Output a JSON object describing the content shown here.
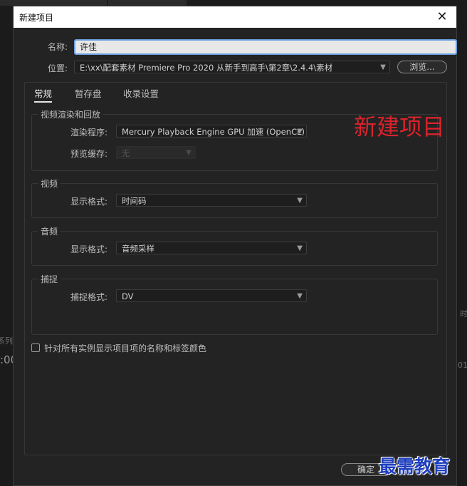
{
  "background": {
    "left_label": "系列",
    "left_time": ":00",
    "right_label": "时",
    "right_time": "01:"
  },
  "dialog": {
    "title": "新建项目",
    "close_glyph": "✕",
    "name_label": "名称:",
    "name_value": "许佳",
    "location_label": "位置:",
    "location_value": "E:\\xx\\配套素材 Premiere Pro 2020 从新手到高手\\第2章\\2.4.4\\素材",
    "browse_label": "浏览..."
  },
  "tabs": [
    {
      "label": "常规",
      "active": true
    },
    {
      "label": "暂存盘",
      "active": false
    },
    {
      "label": "收录设置",
      "active": false
    }
  ],
  "groups": {
    "render": {
      "title": "视频渲染和回放",
      "renderer_label": "渲染程序:",
      "renderer_value": "Mercury Playback Engine GPU 加速 (OpenCL)",
      "preview_cache_label": "预览缓存:",
      "preview_cache_value": "无"
    },
    "video": {
      "title": "视频",
      "display_format_label": "显示格式:",
      "display_format_value": "时间码"
    },
    "audio": {
      "title": "音频",
      "display_format_label": "显示格式:",
      "display_format_value": "音频采样"
    },
    "capture": {
      "title": "捕捉",
      "capture_format_label": "捕捉格式:",
      "capture_format_value": "DV"
    }
  },
  "checkbox_label": "针对所有实例显示项目项的名称和标签颜色",
  "ok_label": "确定",
  "overlay_title": "新建项目",
  "watermark": "最需教育",
  "colors": {
    "dialog_bg": "#232323",
    "overlay_red": "#d9232b",
    "watermark_blue": "#1f3fbf",
    "focus_blue": "#6aa0e0"
  }
}
